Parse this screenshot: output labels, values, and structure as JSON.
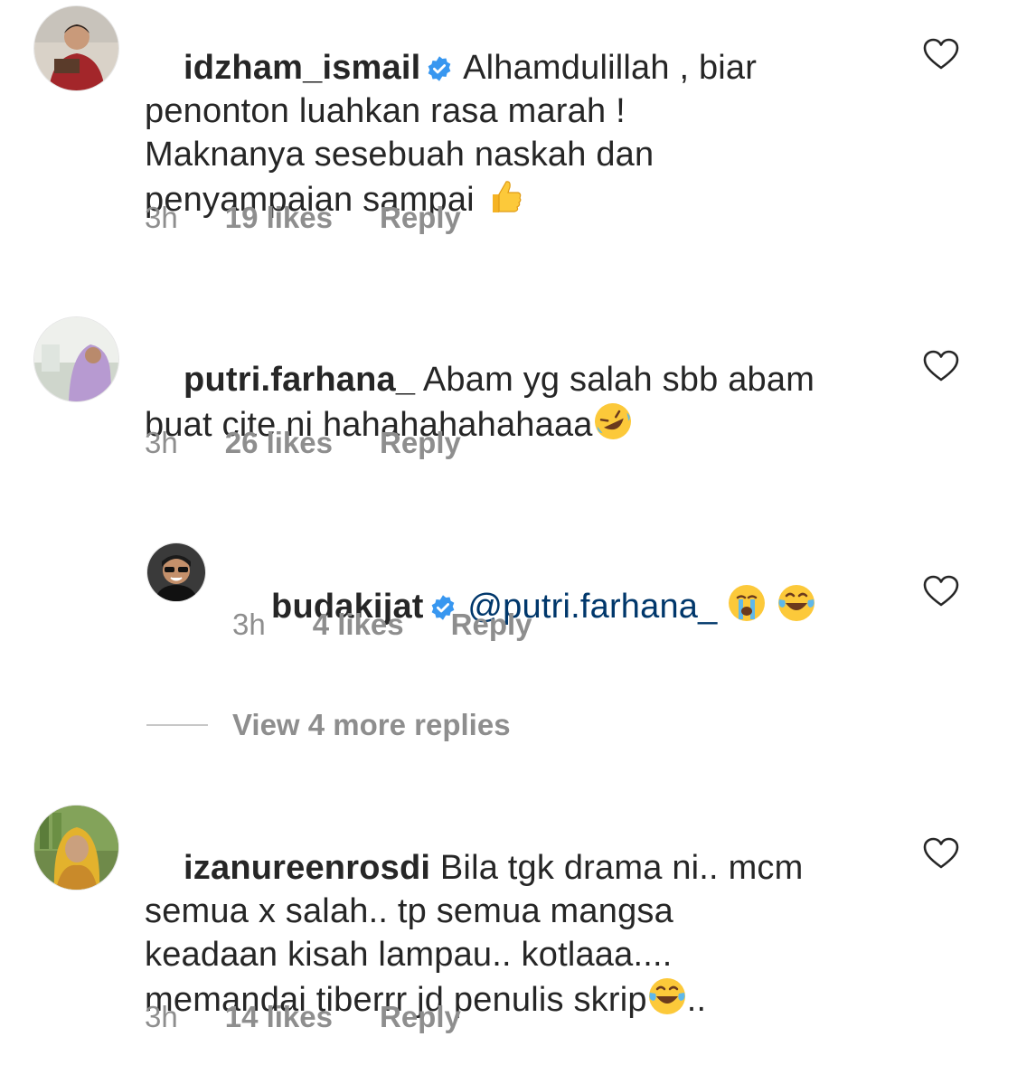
{
  "comments": [
    {
      "username": "idzham_ismail",
      "verified": true,
      "text_line1": " Alhamdulillah , biar",
      "text_rest": "penonton luahkan rasa marah !\nMaknanya sesebuah naskah dan\npenyampaian sampai ",
      "emoji_icon": "thumbs-up-icon",
      "time": "3h",
      "likes": "19 likes",
      "reply": "Reply"
    },
    {
      "username": "putri.farhana_",
      "verified": false,
      "text": " Abam yg salah sbb abam\nbuat cite ni hahahahahahaaa",
      "emoji_icon": "rolling-laughing-icon",
      "time": "3h",
      "likes": "26 likes",
      "reply": "Reply"
    },
    {
      "username": "budakijat",
      "verified": true,
      "mention": "@putri.farhana_",
      "emoji_icons": [
        "crying-face-icon",
        "tears-of-joy-icon"
      ],
      "time": "3h",
      "likes": "4 likes",
      "reply": "Reply"
    },
    {
      "username": "izanureenrosdi",
      "verified": false,
      "text": " Bila tgk drama ni.. mcm\nsemua x salah.. tp semua mangsa\nkeadaan kisah lampau.. kotlaaa....\nmemandai tiberrr jd penulis skrip",
      "text_after_emoji": "..",
      "emoji_icon": "tears-of-joy-icon",
      "time": "3h",
      "likes": "14 likes",
      "reply": "Reply"
    }
  ],
  "view_more_replies": "View 4 more replies",
  "colors": {
    "text": "#262626",
    "meta": "#8e8e8e",
    "mention": "#00376b",
    "verified": "#3897f0"
  }
}
